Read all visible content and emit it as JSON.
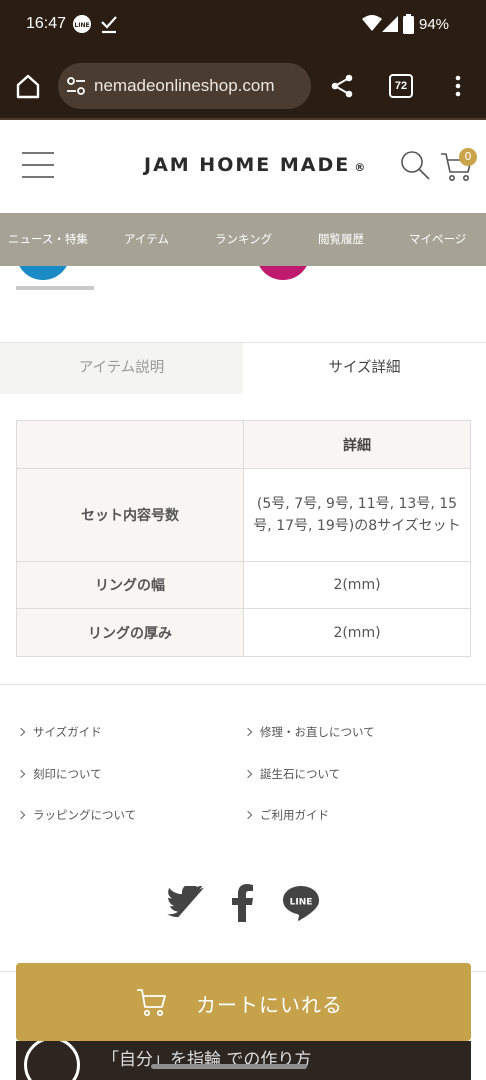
{
  "status_bar": {
    "time": "16:47",
    "battery": "94%"
  },
  "browser": {
    "url": "nemadeonlineshop.com",
    "tab_count": "72"
  },
  "header": {
    "logo": "JAM HOME MADE",
    "logo_mark": "®",
    "cart_count": "0"
  },
  "nav": [
    "ニュース・特集",
    "アイテム",
    "ランキング",
    "閲覧履歴",
    "マイページ"
  ],
  "tabs": {
    "description": "アイテム説明",
    "size_detail": "サイズ詳細"
  },
  "table": {
    "header": "詳細",
    "rows": [
      {
        "label": "セット内容号数",
        "value": "(5号, 7号, 9号, 11号, 13号, 15号, 17号, 19号)の8サイズセット"
      },
      {
        "label": "リングの幅",
        "value": "2(mm)"
      },
      {
        "label": "リングの厚み",
        "value": "2(mm)"
      }
    ]
  },
  "footer_links": [
    "サイズガイド",
    "修理・お直しについて",
    "刻印について",
    "誕生石について",
    "ラッピングについて",
    "ご利用ガイド"
  ],
  "social": {
    "line_label": "LINE"
  },
  "cart_button": {
    "label": "カートにいれる"
  },
  "bottom_banner": {
    "text": "「自分」を指輪 での作り方"
  },
  "colors": {
    "gold": "#c6a24a",
    "nav_bg": "#a6a396",
    "browser_bg": "#2a1d13"
  }
}
